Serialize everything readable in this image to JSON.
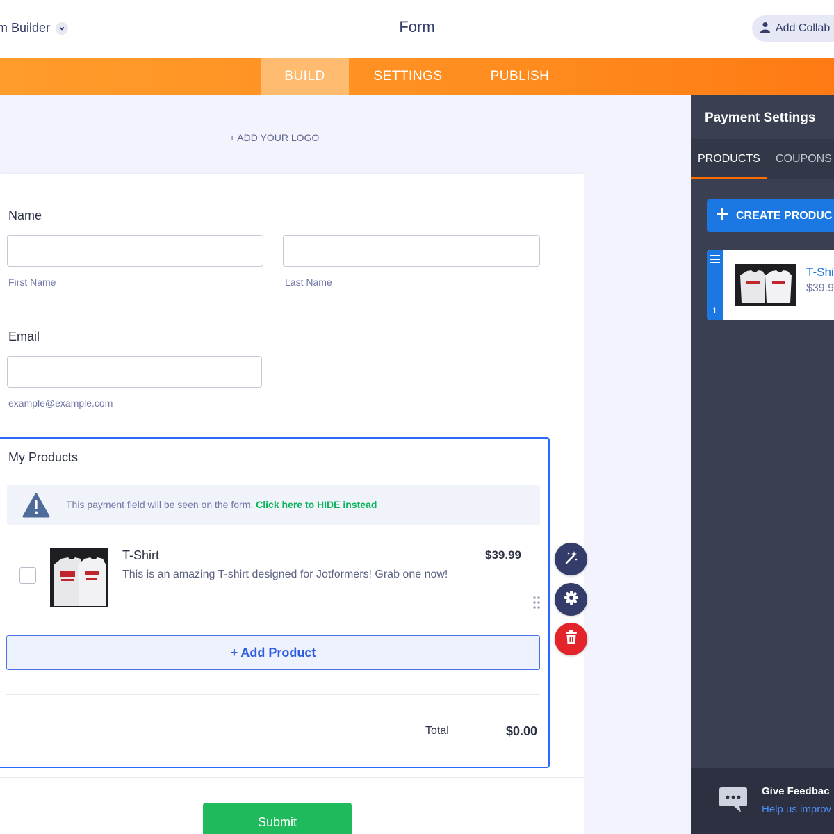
{
  "header": {
    "app_title": "rm Builder",
    "form_title": "Form",
    "collab_label": "Add Collab"
  },
  "nav": {
    "tabs": [
      {
        "label": "BUILD",
        "active": true
      },
      {
        "label": "SETTINGS",
        "active": false
      },
      {
        "label": "PUBLISH",
        "active": false
      }
    ]
  },
  "form": {
    "logo_label": "+ ADD YOUR LOGO",
    "name": {
      "label": "Name",
      "first_sublabel": "First Name",
      "last_sublabel": "Last Name"
    },
    "email": {
      "label": "Email",
      "sublabel": "example@example.com"
    },
    "products": {
      "label": "My Products",
      "notice_text": "This payment field will be seen on the form.",
      "notice_link": "Click here to HIDE instead",
      "item": {
        "name": "T-Shirt",
        "price": "$39.99",
        "description": "This is an amazing T-shirt designed for Jotformers! Grab one now!"
      },
      "add_product_label": "+ Add Product",
      "total_label": "Total",
      "total_value": "$0.00"
    },
    "submit_label": "Submit"
  },
  "panel": {
    "title": "Payment Settings",
    "tabs": [
      {
        "label": "PRODUCTS",
        "active": true
      },
      {
        "label": "COUPONS",
        "active": false
      }
    ],
    "create_label": "CREATE PRODUC",
    "product_card": {
      "index": "1",
      "name": "T-Shi",
      "price": "$39.9"
    },
    "feedback": {
      "title": "Give Feedbac",
      "subtitle": "Help us improv"
    }
  },
  "colors": {
    "accent_orange": "#ff8d1f",
    "primary_blue": "#2e69ff",
    "submit_green": "#1fba5c",
    "panel_dark": "#3a3f52",
    "delete_red": "#e3242b"
  },
  "icons": [
    "chevron-down-icon",
    "user-icon",
    "warning-icon",
    "drag-handle-icon",
    "magic-wand-icon",
    "gear-icon",
    "trash-icon",
    "plus-icon",
    "menu-icon",
    "chat-bubble-icon"
  ]
}
